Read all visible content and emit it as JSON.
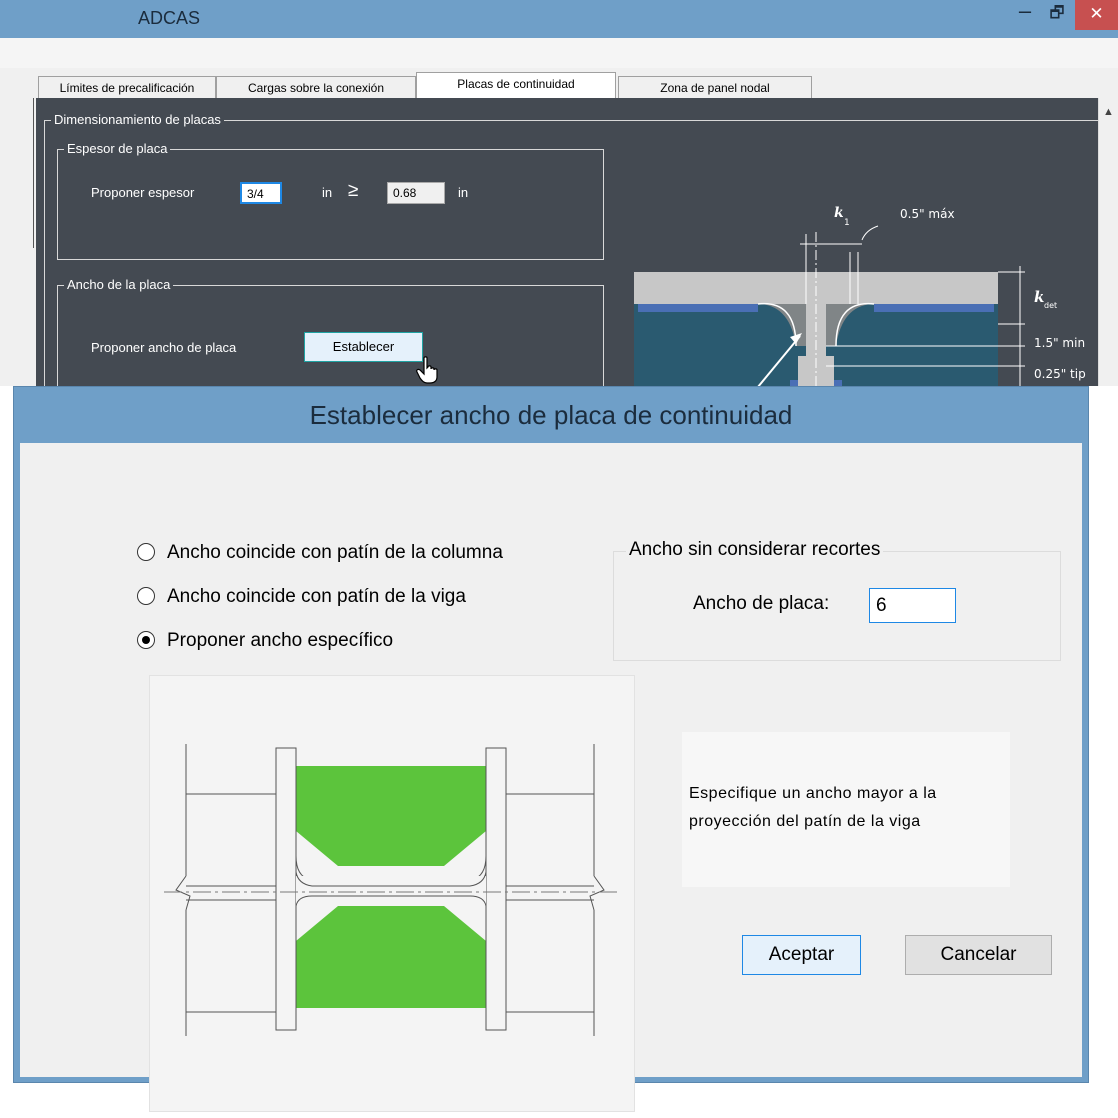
{
  "window": {
    "title": "ADCAS",
    "controls": {
      "minimize": "–",
      "maximize": "🗗",
      "close": "✕"
    }
  },
  "tabs": [
    {
      "label": "Límites de precalificación",
      "active": false
    },
    {
      "label": "Cargas sobre la conexión",
      "active": false
    },
    {
      "label": "Placas de continuidad",
      "active": true
    },
    {
      "label": "Zona de panel nodal",
      "active": false
    }
  ],
  "dimensionamiento": {
    "title": "Dimensionamiento de placas",
    "espesor": {
      "title": "Espesor de placa",
      "label": "Proponer espesor",
      "value": "3/4",
      "unit": "in",
      "comparator": "≥",
      "required": "0.68",
      "required_unit": "in"
    },
    "ancho": {
      "title": "Ancho de la placa",
      "label": "Proponer ancho de placa",
      "button": "Establecer"
    },
    "detail": {
      "k1": "k",
      "k1_sub": "1",
      "k1_note": "0.5\" máx",
      "kdet": "k",
      "kdet_sub": "det",
      "min": "1.5\" min",
      "tip": "0.25\" tip"
    }
  },
  "dialog": {
    "title": "Establecer ancho de placa de continuidad",
    "options": [
      {
        "label": "Ancho coincide con patín de la columna",
        "checked": false
      },
      {
        "label": "Ancho coincide con patín de la viga",
        "checked": false
      },
      {
        "label": "Proponer ancho específico",
        "checked": true
      }
    ],
    "sin_recortes": {
      "title": "Ancho sin considerar recortes",
      "label": "Ancho de placa:",
      "value": "6"
    },
    "hint": "Especifique un ancho mayor a la proyección del patín de la viga",
    "accept": "Aceptar",
    "cancel": "Cancelar"
  },
  "colors": {
    "titlebar": "#6f9fc8",
    "panel": "#444a52",
    "plate_fill": "#5cc43c",
    "accent": "#1e88e5",
    "close": "#c75050"
  },
  "icons": {
    "cursor": "hand-pointer-icon",
    "scroll": "scroll-up-icon"
  }
}
